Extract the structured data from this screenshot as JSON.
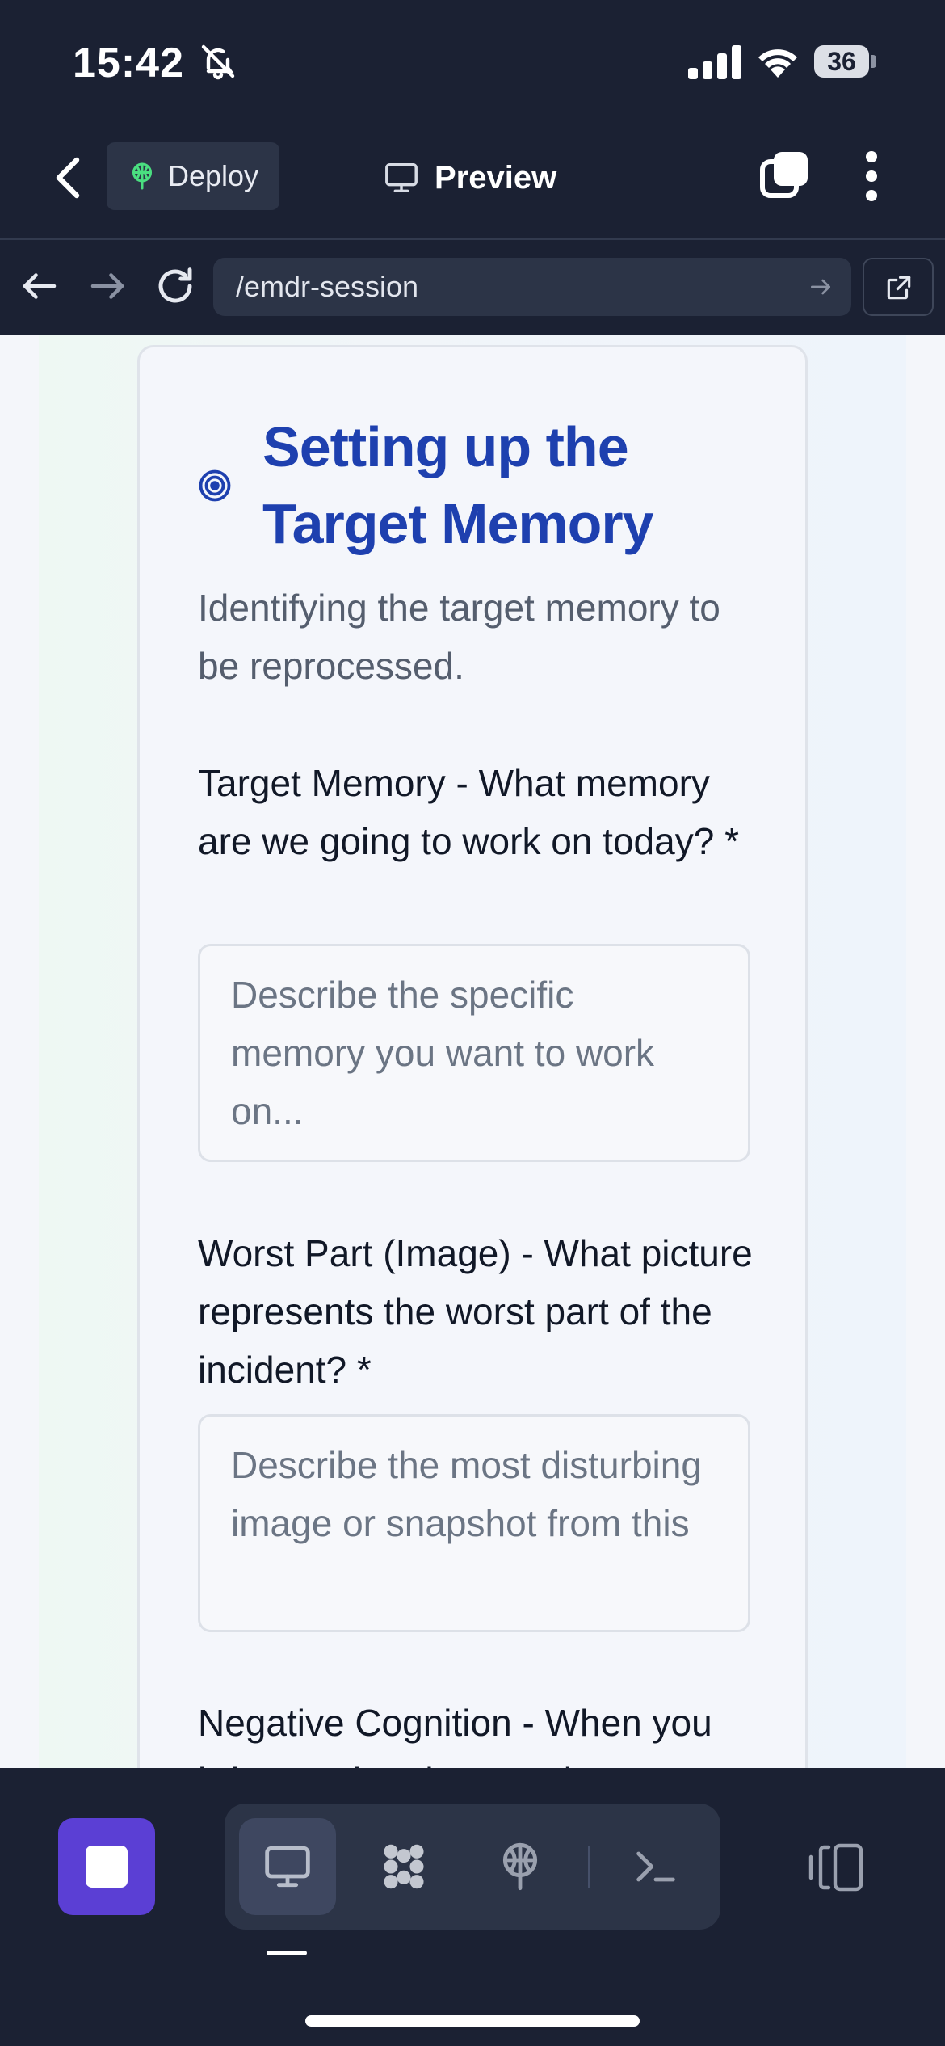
{
  "status_bar": {
    "time": "15:42",
    "battery": "36"
  },
  "app_bar": {
    "deploy_label": "Deploy",
    "preview_label": "Preview"
  },
  "url_bar": {
    "url": "/emdr-session"
  },
  "card": {
    "title": "Setting up the Target Memory",
    "subtitle": "Identifying the target memory to be reprocessed.",
    "questions": [
      {
        "label": "Target Memory - What memory are we going to work on today? *",
        "placeholder": "Describe the specific memory you want to work on..."
      },
      {
        "label": "Worst Part (Image) - What picture represents the worst part of the incident? *",
        "placeholder": "Describe the most disturbing image or snapshot from this"
      },
      {
        "label": "Negative Cognition - When you bring up the picture, what"
      }
    ]
  },
  "colors": {
    "accent": "#1e40af",
    "primary_button": "#5b3fd4",
    "chrome": "#1b2133"
  }
}
